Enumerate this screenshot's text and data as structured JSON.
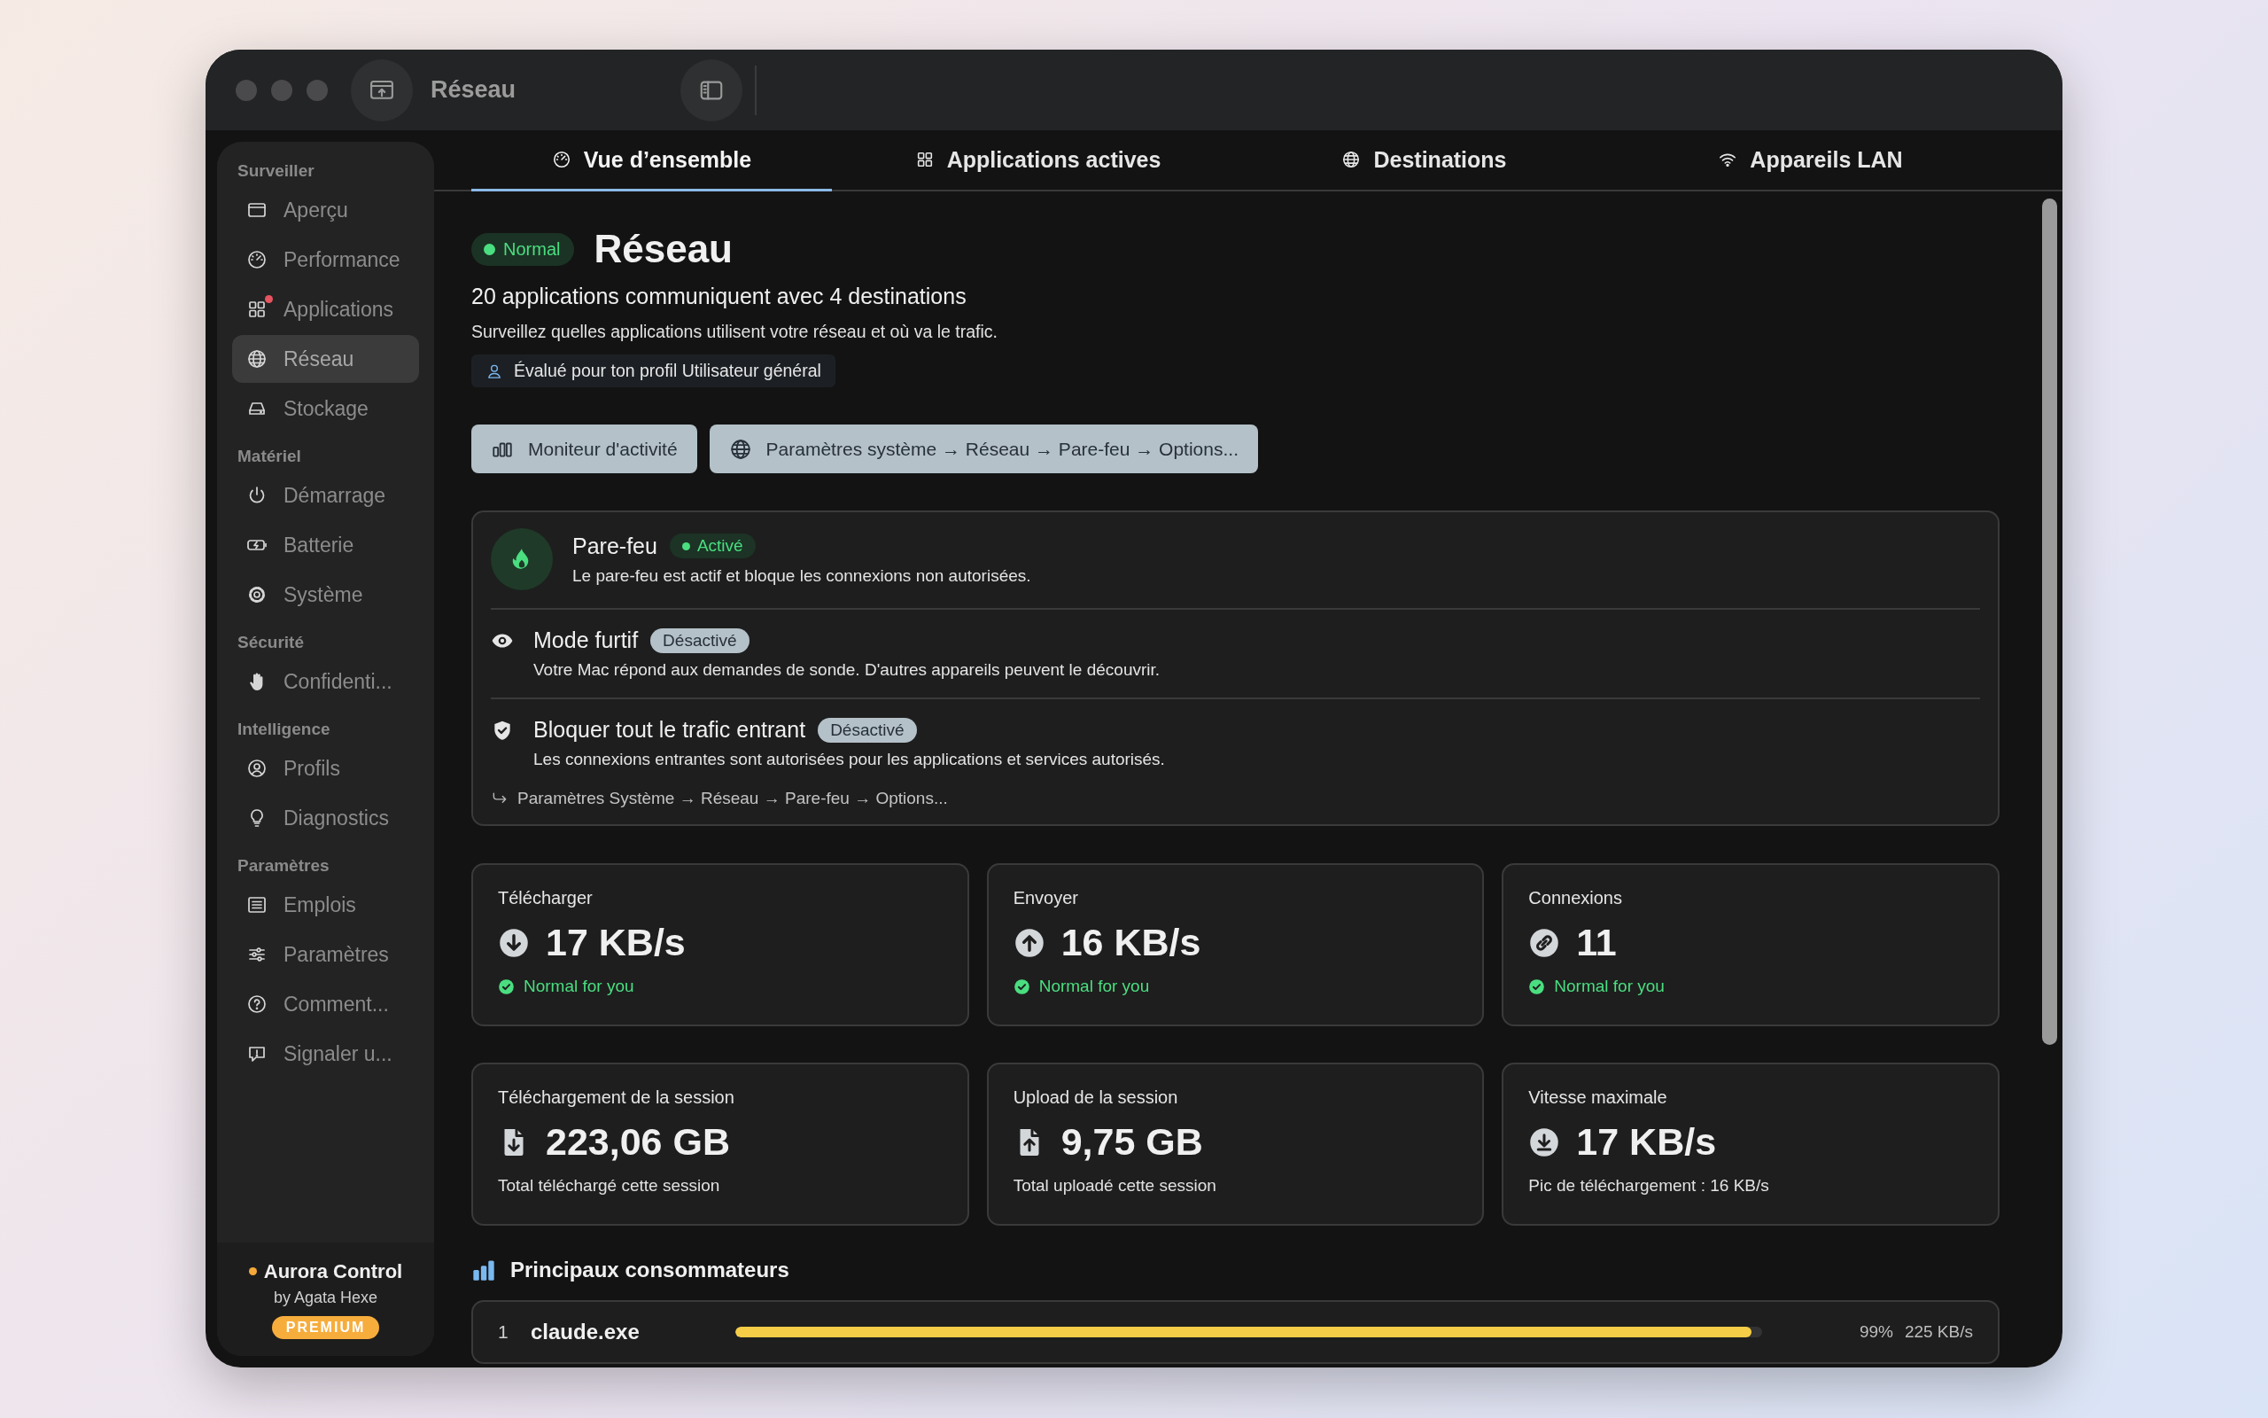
{
  "window": {
    "title": "Réseau"
  },
  "sidebar": {
    "sections": [
      {
        "label": "Surveiller",
        "items": [
          {
            "label": "Aperçu",
            "selected": false,
            "alert": false
          },
          {
            "label": "Performance",
            "selected": false,
            "alert": false
          },
          {
            "label": "Applications",
            "selected": false,
            "alert": true
          },
          {
            "label": "Réseau",
            "selected": true,
            "alert": false
          },
          {
            "label": "Stockage",
            "selected": false,
            "alert": false
          }
        ]
      },
      {
        "label": "Matériel",
        "items": [
          {
            "label": "Démarrage",
            "selected": false,
            "alert": false
          },
          {
            "label": "Batterie",
            "selected": false,
            "alert": false
          },
          {
            "label": "Système",
            "selected": false,
            "alert": false
          }
        ]
      },
      {
        "label": "Sécurité",
        "items": [
          {
            "label": "Confidenti...",
            "selected": false,
            "alert": false
          }
        ]
      },
      {
        "label": "Intelligence",
        "items": [
          {
            "label": "Profils",
            "selected": false,
            "alert": false
          },
          {
            "label": "Diagnostics",
            "selected": false,
            "alert": false
          }
        ]
      },
      {
        "label": "Paramètres",
        "items": [
          {
            "label": "Emplois",
            "selected": false,
            "alert": false
          },
          {
            "label": "Paramètres",
            "selected": false,
            "alert": false
          },
          {
            "label": "Comment...",
            "selected": false,
            "alert": false
          },
          {
            "label": "Signaler u...",
            "selected": false,
            "alert": false
          }
        ]
      }
    ],
    "footer": {
      "app_name": "Aurora Control",
      "author": "by Agata Hexe",
      "badge": "PREMIUM"
    }
  },
  "tabs": [
    {
      "label": "Vue d’ensemble",
      "selected": true
    },
    {
      "label": "Applications actives",
      "selected": false
    },
    {
      "label": "Destinations",
      "selected": false
    },
    {
      "label": "Appareils LAN",
      "selected": false
    }
  ],
  "header": {
    "status": "Normal",
    "title": "Réseau",
    "summary": "20 applications communiquent avec 4 destinations",
    "description": "Surveillez quelles applications utilisent votre réseau et où va le trafic.",
    "profile": "Évalué pour ton profil Utilisateur général"
  },
  "actions": [
    "Moniteur d'activité",
    "Paramètres système → Réseau → Pare-feu → Options..."
  ],
  "firewall": {
    "items": [
      {
        "kind": "primary",
        "title": "Pare-feu",
        "status": "Activé",
        "on": true,
        "description": "Le pare-feu est actif et bloque les connexions non autorisées."
      },
      {
        "kind": "option",
        "title": "Mode furtif",
        "status": "Désactivé",
        "on": false,
        "description": "Votre Mac répond aux demandes de sonde. D'autres appareils peuvent le découvrir."
      },
      {
        "kind": "option",
        "title": "Bloquer tout le trafic entrant",
        "status": "Désactivé",
        "on": false,
        "description": "Les connexions entrantes sont autorisées pour les applications et services autorisés."
      }
    ],
    "path": "Paramètres Système → Réseau → Pare-feu → Options..."
  },
  "stats": [
    {
      "label": "Télécharger",
      "value": "17 KB/s",
      "note": "Normal for you",
      "note_ok": true
    },
    {
      "label": "Envoyer",
      "value": "16 KB/s",
      "note": "Normal for you",
      "note_ok": true
    },
    {
      "label": "Connexions",
      "value": "11",
      "note": "Normal for you",
      "note_ok": true
    },
    {
      "label": "Téléchargement de la session",
      "value": "223,06 GB",
      "note": "Total téléchargé cette session",
      "note_ok": false
    },
    {
      "label": "Upload de la session",
      "value": "9,75 GB",
      "note": "Total uploadé cette session",
      "note_ok": false
    },
    {
      "label": "Vitesse maximale",
      "value": "17 KB/s",
      "note": "Pic de téléchargement : 16 KB/s",
      "note_ok": false
    }
  ],
  "top_consumers": {
    "title": "Principaux consommateurs",
    "rows": [
      {
        "rank": "1",
        "name": "claude.exe",
        "level": 0.99,
        "percent": "99%",
        "rate": "225 KB/s"
      }
    ]
  }
}
